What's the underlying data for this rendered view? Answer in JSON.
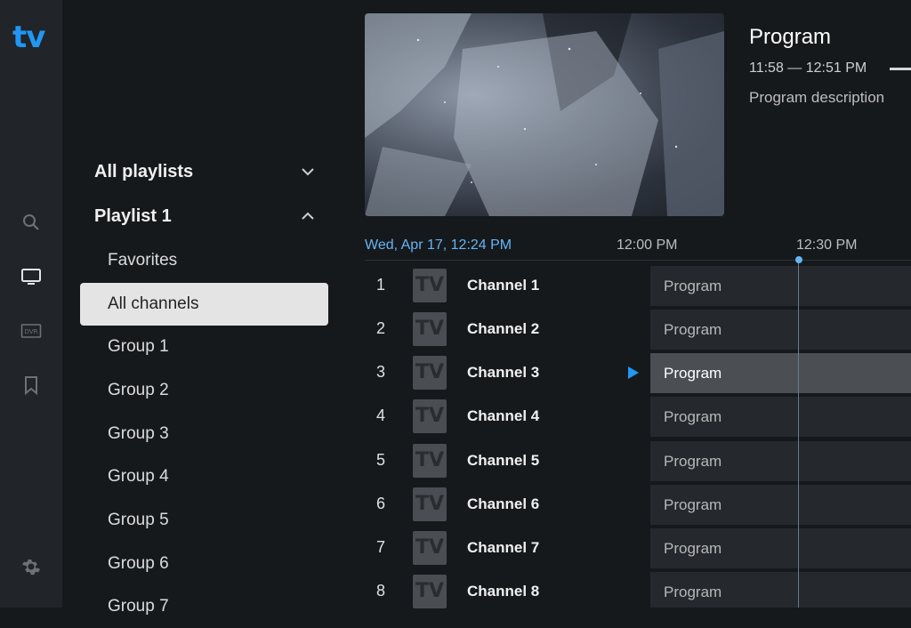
{
  "app": {
    "logo_text": "tv",
    "accent_color": "#2196f3"
  },
  "rail": {
    "items": [
      {
        "icon": "search-icon"
      },
      {
        "icon": "tv-icon"
      },
      {
        "icon": "dvr-icon",
        "label": "DVR"
      },
      {
        "icon": "bookmark-icon"
      },
      {
        "icon": "gear-icon"
      }
    ]
  },
  "playlists": {
    "all_playlists_label": "All playlists",
    "playlist_label": "Playlist 1",
    "items": [
      {
        "label": "Favorites"
      },
      {
        "label": "All channels",
        "selected": true
      },
      {
        "label": "Group 1"
      },
      {
        "label": "Group 2"
      },
      {
        "label": "Group 3"
      },
      {
        "label": "Group 4"
      },
      {
        "label": "Group 5"
      },
      {
        "label": "Group 6"
      },
      {
        "label": "Group 7"
      }
    ]
  },
  "info": {
    "title": "Program",
    "time": "11:58 — 12:51 PM",
    "description": "Program description"
  },
  "timeline": {
    "date": "Wed, Apr 17, 12:24 PM",
    "times": [
      "12:00 PM",
      "12:30 PM"
    ]
  },
  "channels": [
    {
      "num": "1",
      "logo": "TV",
      "name": "Channel 1",
      "program": "Program"
    },
    {
      "num": "2",
      "logo": "TV",
      "name": "Channel 2",
      "program": "Program"
    },
    {
      "num": "3",
      "logo": "TV",
      "name": "Channel 3",
      "program": "Program",
      "playing": true
    },
    {
      "num": "4",
      "logo": "TV",
      "name": "Channel 4",
      "program": "Program"
    },
    {
      "num": "5",
      "logo": "TV",
      "name": "Channel 5",
      "program": "Program"
    },
    {
      "num": "6",
      "logo": "TV",
      "name": "Channel 6",
      "program": "Program"
    },
    {
      "num": "7",
      "logo": "TV",
      "name": "Channel 7",
      "program": "Program"
    },
    {
      "num": "8",
      "logo": "TV",
      "name": "Channel 8",
      "program": "Program"
    }
  ]
}
